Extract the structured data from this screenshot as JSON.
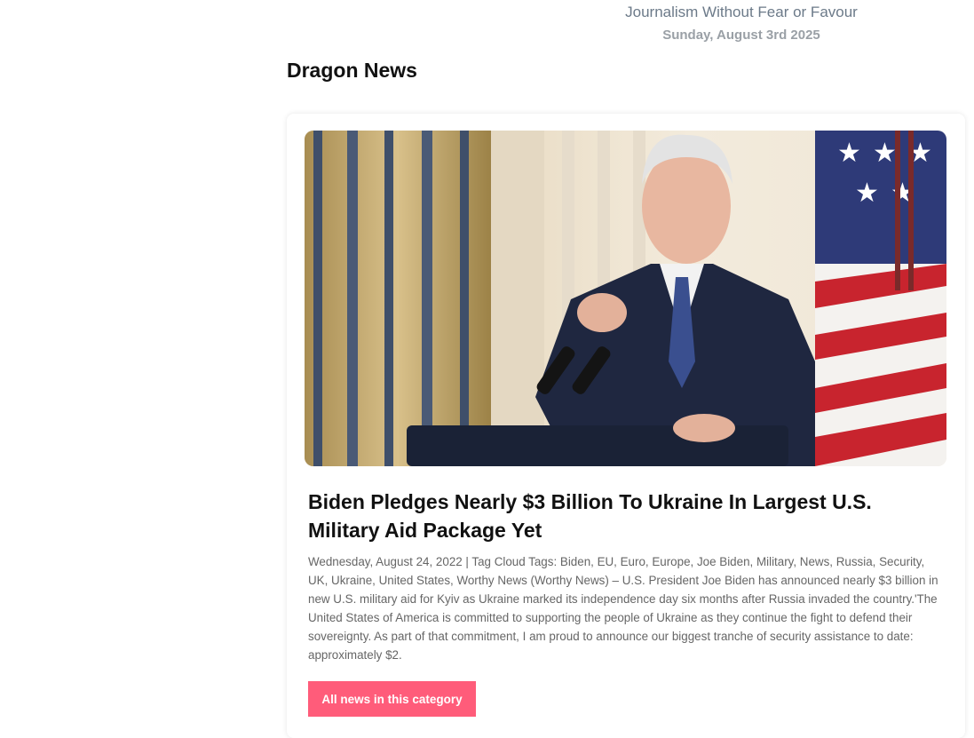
{
  "header": {
    "tagline": "Journalism Without Fear or Favour",
    "date": "Sunday, August 3rd 2025"
  },
  "section": {
    "title": "Dragon News"
  },
  "article": {
    "headline": "Biden Pledges Nearly $3 Billion To Ukraine In Largest U.S. Military Aid Package Yet",
    "excerpt": "Wednesday, August 24, 2022 | Tag Cloud Tags: Biden, EU, Euro, Europe, Joe Biden, Military, News, Russia, Security, UK, Ukraine, United States, Worthy News (Worthy News) – U.S. President Joe Biden has announced nearly $3 billion in new U.S. military aid for Kyiv as Ukraine marked its independence day six months after Russia invaded the country.'The United States of America is committed to supporting the people of Ukraine as they continue the fight to defend their sovereignty. As part of that commitment, I am proud to announce our biggest tranche of security assistance to date: approximately $2.",
    "button_label": "All news in this category"
  },
  "colors": {
    "accent": "#ff5c7a"
  }
}
